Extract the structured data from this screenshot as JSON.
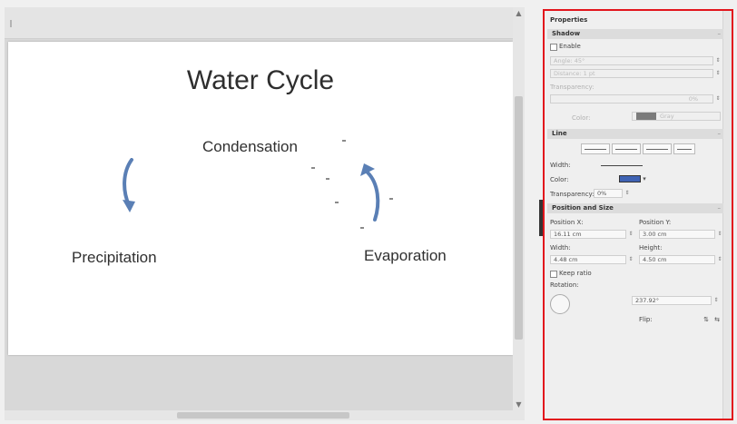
{
  "slide": {
    "title": "Water Cycle",
    "labels": {
      "condensation": "Condensation",
      "precipitation": "Precipitation",
      "evaporation": "Evaporation"
    },
    "arrow_color": "#5a7fb5"
  },
  "sidebar": {
    "title": "Properties",
    "border_color": "#e2151c",
    "shadow": {
      "header": "Shadow",
      "enable_label": "Enable",
      "angle_label": "Angle: 45°",
      "distance_label": "Distance: 1 pt",
      "transparency_label": "Transparency:",
      "transparency_value": "0%",
      "color_label": "Color:",
      "color_value": "Gray"
    },
    "line": {
      "header": "Line",
      "width_label": "Width:",
      "color_label": "Color:",
      "transparency_label": "Transparency:",
      "transparency_value": "0%",
      "line_color": "#3f63b4"
    },
    "position_size": {
      "header": "Position and Size",
      "position_x_label": "Position X:",
      "position_x_value": "16.11 cm",
      "position_y_label": "Position Y:",
      "position_y_value": "3.00 cm",
      "width_label": "Width:",
      "width_value": "4.48 cm",
      "height_label": "Height:",
      "height_value": "4.50 cm",
      "keep_ratio_label": "Keep ratio",
      "rotation_label": "Rotation:",
      "rotation_value": "237.92°",
      "flip_label": "Flip:"
    }
  }
}
